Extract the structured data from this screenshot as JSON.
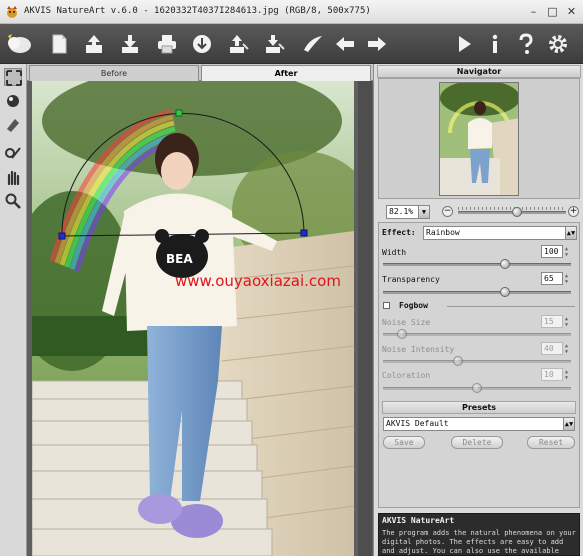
{
  "window": {
    "title": "AKVIS NatureArt v.6.0 - 1620332T4037I284613.jpg (RGB/8, 500x775)",
    "controls": {
      "minimize": "–",
      "maximize": "□",
      "close": "✕"
    }
  },
  "toolbar": {
    "left_icons": [
      "effects-icon",
      "new-document-icon",
      "open-file-icon",
      "save-file-icon",
      "print-icon",
      "share-icon",
      "import-preset-icon",
      "export-preset-icon",
      "brush-presets-icon",
      "undo-arrow-icon",
      "redo-arrow-icon"
    ],
    "right_icons": [
      "run-icon",
      "info-icon",
      "help-icon",
      "settings-icon"
    ]
  },
  "tools": [
    "zoom-fit-icon",
    "apply-mask-icon",
    "eraser-icon",
    "guided-brush-icon",
    "hand-icon",
    "zoom-icon"
  ],
  "tabs": {
    "before": "Before",
    "after": "After"
  },
  "watermark": "www.ouyaoxiazai.com",
  "navigator": {
    "title": "Navigator",
    "zoom_value": "82.1%",
    "zoom_minus": "−",
    "zoom_plus": "+",
    "zoom_level_fraction": 0.55
  },
  "effect": {
    "label": "Effect:",
    "selected": "Rainbow"
  },
  "params": {
    "width_label": "Width",
    "width_value": "100",
    "width_fraction": 0.65,
    "transparency_label": "Transparency",
    "transparency_value": "65",
    "transparency_fraction": 0.65,
    "fogbow_label": "Fogbow",
    "fogbow_checked": false,
    "noise_size_label": "Noise Size",
    "noise_size_value": "15",
    "noise_size_fraction": 0.1,
    "noise_intensity_label": "Noise Intensity",
    "noise_intensity_value": "40",
    "noise_intensity_fraction": 0.4,
    "coloration_label": "Coloration",
    "coloration_value": "10",
    "coloration_fraction": 0.5
  },
  "presets": {
    "title": "Presets",
    "selected": "AKVIS Default",
    "save_label": "Save",
    "delete_label": "Delete",
    "reset_label": "Reset"
  },
  "description": {
    "title": "AKVIS NatureArt",
    "text": "The program adds the natural phenomena on your digital photos. The effects are easy to add and adjust. You can also use the available presets to get a quick result."
  },
  "colors": {
    "toolbar_bg": "#4a4a4a",
    "panel_bg": "#dcdcdc",
    "watermark": "#e0141a",
    "rainbow_arc": "#1a1a1a",
    "handle_green": "#2ecc40",
    "handle_blue": "#1c2fd6"
  }
}
